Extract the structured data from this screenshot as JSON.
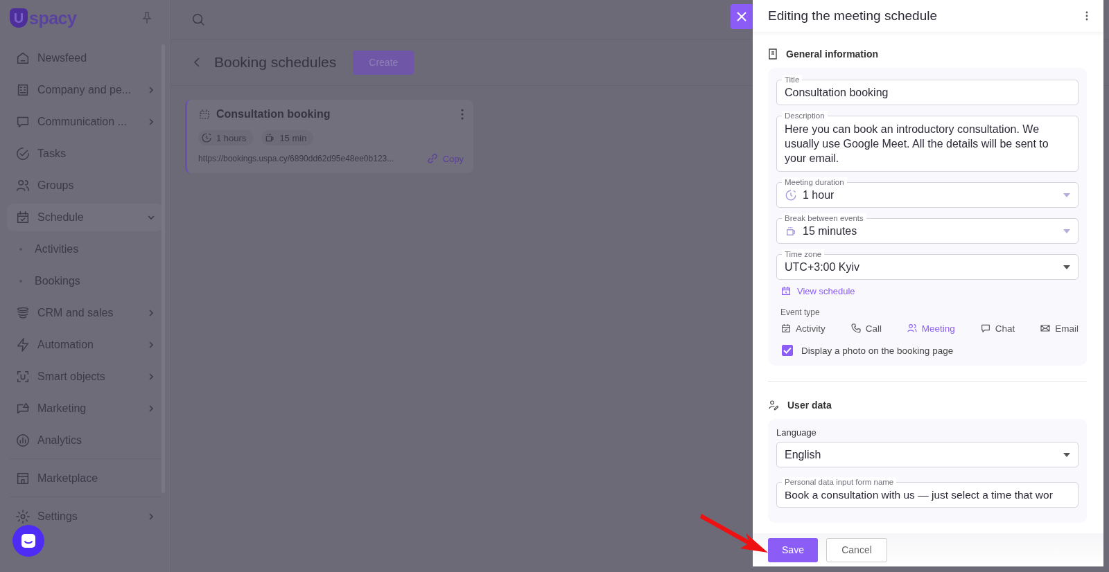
{
  "logo": {
    "mark": "U",
    "text": "spacy"
  },
  "sidebar": {
    "items": [
      {
        "label": "Newsfeed",
        "has_arrow": false
      },
      {
        "label": "Company and pe...",
        "has_arrow": true
      },
      {
        "label": "Communication ...",
        "has_arrow": true
      },
      {
        "label": "Tasks",
        "has_arrow": false
      },
      {
        "label": "Groups",
        "has_arrow": false
      },
      {
        "label": "Schedule",
        "has_arrow": true,
        "expanded": true,
        "children": [
          {
            "label": "Activities"
          },
          {
            "label": "Bookings"
          }
        ]
      },
      {
        "label": "CRM and sales",
        "has_arrow": true
      },
      {
        "label": "Automation",
        "has_arrow": true
      },
      {
        "label": "Smart objects",
        "has_arrow": true
      },
      {
        "label": "Marketing",
        "has_arrow": true
      },
      {
        "label": "Analytics",
        "has_arrow": false
      },
      {
        "label": "Marketplace",
        "has_arrow": false
      },
      {
        "label": "Settings",
        "has_arrow": true
      }
    ]
  },
  "page": {
    "title": "Booking schedules",
    "create_button": "Create",
    "card": {
      "title": "Consultation booking",
      "duration": "1 hours",
      "break": "15 min",
      "url": "https://bookings.uspa.cy/6890dd62d95e48ee0b123...",
      "copy": "Copy"
    }
  },
  "panel": {
    "title": "Editing the meeting schedule",
    "general": {
      "heading": "General information",
      "fields": [
        {
          "kind": "text",
          "label": "Title",
          "value": "Consultation booking"
        },
        {
          "kind": "textarea",
          "label": "Description",
          "value": "Here you can book an introductory consultation. We usually use Google Meet. All the details will be sent to your email."
        },
        {
          "kind": "select",
          "label": "Meeting duration",
          "value": "1 hour"
        },
        {
          "kind": "select",
          "label": "Break between events",
          "value": "15 minutes"
        },
        {
          "kind": "select",
          "label": "Time zone",
          "value": "UTC+3:00 Kyiv"
        }
      ],
      "view_schedule": "View schedule",
      "event_type_label": "Event type",
      "event_types": [
        {
          "label": "Activity",
          "selected": false
        },
        {
          "label": "Call",
          "selected": false
        },
        {
          "label": "Meeting",
          "selected": true
        },
        {
          "label": "Chat",
          "selected": false
        },
        {
          "label": "Email",
          "selected": false
        }
      ],
      "photo_checkbox": {
        "label": "Display a photo on the booking page",
        "checked": true
      }
    },
    "user_data": {
      "heading": "User data",
      "language_label": "Language",
      "language": "English",
      "form_name": {
        "label": "Personal data input form name",
        "value": "Book a consultation with us — just select a time that wor"
      }
    },
    "buttons": [
      {
        "label": "Save",
        "kind": "primary"
      },
      {
        "label": "Cancel",
        "kind": "secondary"
      }
    ]
  }
}
